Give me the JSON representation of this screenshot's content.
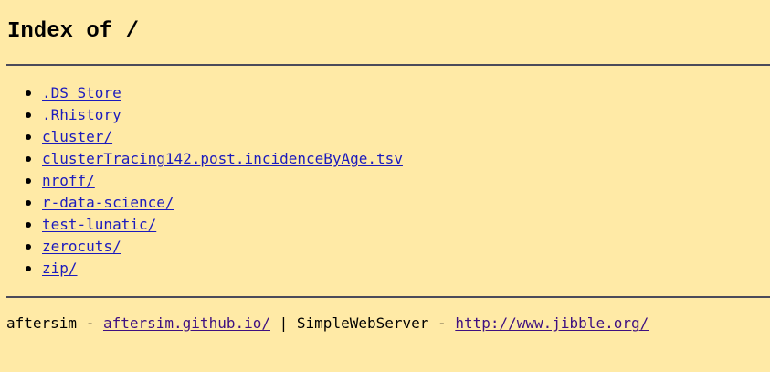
{
  "page": {
    "title": "Index of /"
  },
  "files": [
    {
      "name": ".DS_Store"
    },
    {
      "name": ".Rhistory"
    },
    {
      "name": "cluster/"
    },
    {
      "name": "clusterTracing142.post.incidenceByAge.tsv"
    },
    {
      "name": "nroff/"
    },
    {
      "name": "r-data-science/"
    },
    {
      "name": "test-lunatic/"
    },
    {
      "name": "zerocuts/"
    },
    {
      "name": "zip/"
    }
  ],
  "footer": {
    "author": "aftersim",
    "separator1": " - ",
    "author_link": "aftersim.github.io/",
    "divider": " | ",
    "server": "SimpleWebServer",
    "separator2": " - ",
    "server_link": "http://www.jibble.org/"
  },
  "colors": {
    "background": "#ffeaa6",
    "link": "#1c1bbd",
    "visited_link": "#3f1080",
    "rule": "#4b4b5a"
  }
}
